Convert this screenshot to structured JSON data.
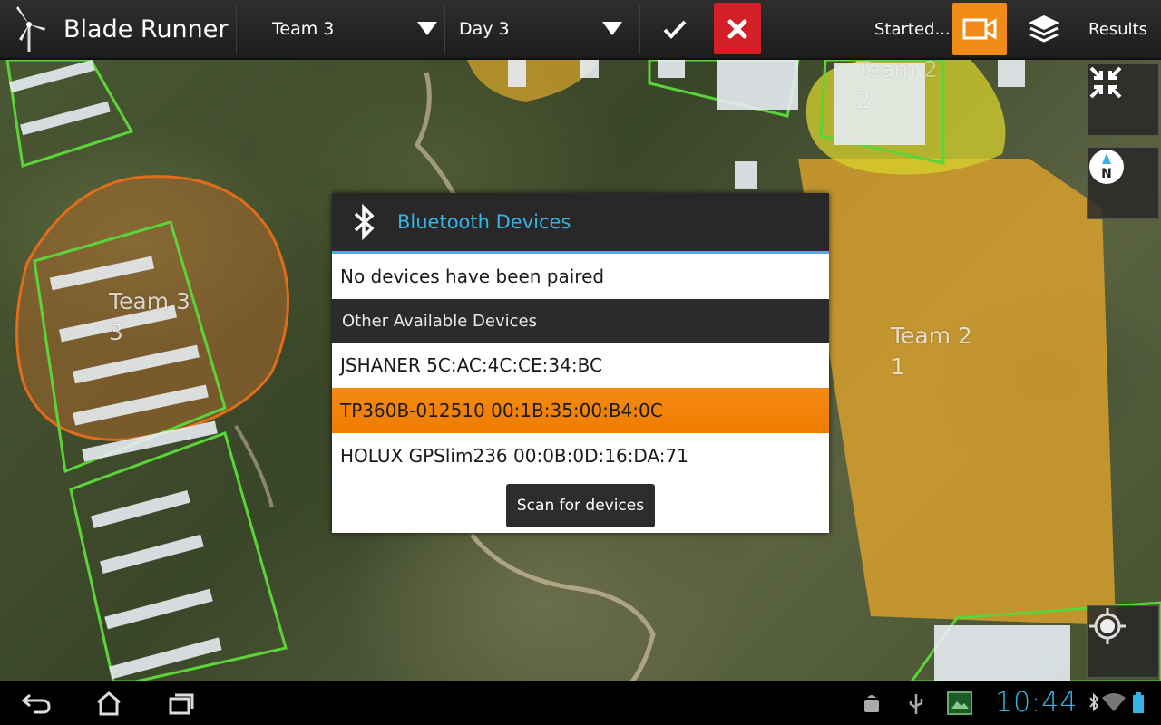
{
  "app": {
    "title": "Blade Runner",
    "icon": "wind-turbine-icon"
  },
  "toolbar": {
    "team_spinner": {
      "selected": "Team 3"
    },
    "day_spinner": {
      "selected": "Day 3"
    },
    "status": "Started...",
    "results": "Results"
  },
  "map": {
    "labels": [
      {
        "line1": "Team 3",
        "line2": "3"
      },
      {
        "line1": "Team 2",
        "line2": "1"
      },
      {
        "line1": "Team 2",
        "line2": "2"
      }
    ]
  },
  "dialog": {
    "title": "Bluetooth Devices",
    "paired_message": "No devices have been paired",
    "section_title": "Other Available Devices",
    "devices": [
      {
        "label": "JSHANER 5C:AC:4C:CE:34:BC",
        "selected": false
      },
      {
        "label": "TP360B-012510 00:1B:35:00:B4:0C",
        "selected": true
      },
      {
        "label": "HOLUX GPSlim236 00:0B:0D:16:DA:71",
        "selected": false
      }
    ],
    "scan_button": "Scan for devices"
  },
  "system_bar": {
    "clock": "10:44"
  },
  "colors": {
    "accent": "#33b5e5",
    "record": "#ef8b16",
    "cancel": "#d51f26",
    "selected_row": "#f58a12"
  }
}
